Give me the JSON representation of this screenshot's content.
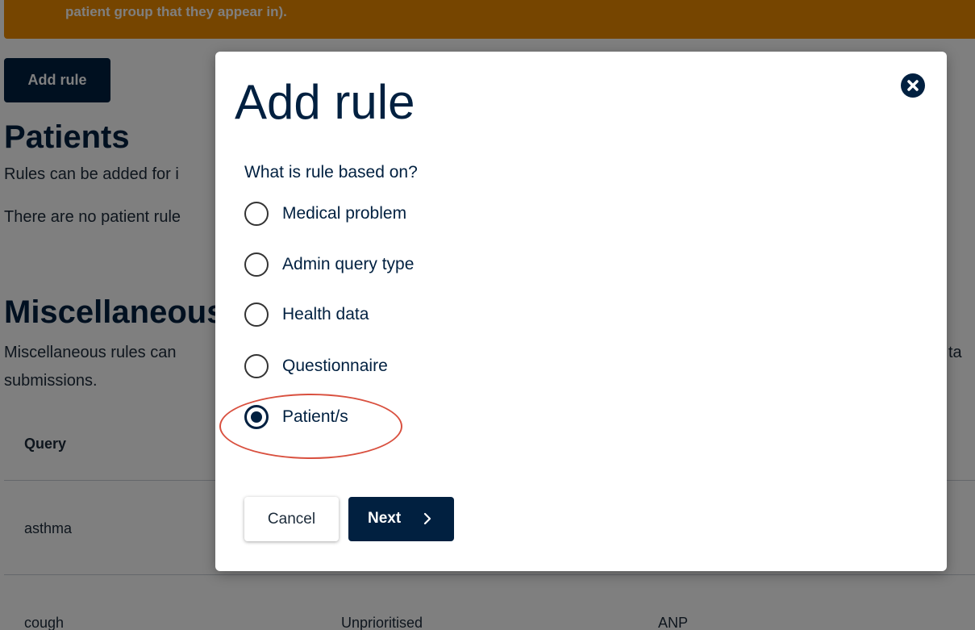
{
  "banner": {
    "text": "patient group that they appear in)."
  },
  "page": {
    "add_rule_label": "Add rule",
    "patients_heading": "Patients",
    "patients_desc": "Rules can be added for i",
    "patients_empty": "There are no patient rule",
    "misc_heading": "Miscellaneous",
    "misc_desc_line1": "Miscellaneous rules can",
    "misc_desc_tail": "ta",
    "misc_desc_line2": "submissions.",
    "table": {
      "headers": [
        "Query"
      ],
      "rows": [
        {
          "query": "asthma"
        },
        {
          "query": "cough",
          "priority": "Unprioritised",
          "assignee": "ANP"
        }
      ]
    }
  },
  "modal": {
    "title": "Add rule",
    "legend": "What is rule based on?",
    "options": [
      {
        "label": "Medical problem",
        "checked": false
      },
      {
        "label": "Admin query type",
        "checked": false
      },
      {
        "label": "Health data",
        "checked": false
      },
      {
        "label": "Questionnaire",
        "checked": false
      },
      {
        "label": "Patient/s",
        "checked": true
      }
    ],
    "cancel_label": "Cancel",
    "next_label": "Next"
  },
  "icons": {
    "close": "close-circle-icon",
    "next": "chevron-right-icon"
  },
  "colors": {
    "primary": "#012040",
    "banner": "#ED8B00",
    "annotation": "#D9503F"
  }
}
